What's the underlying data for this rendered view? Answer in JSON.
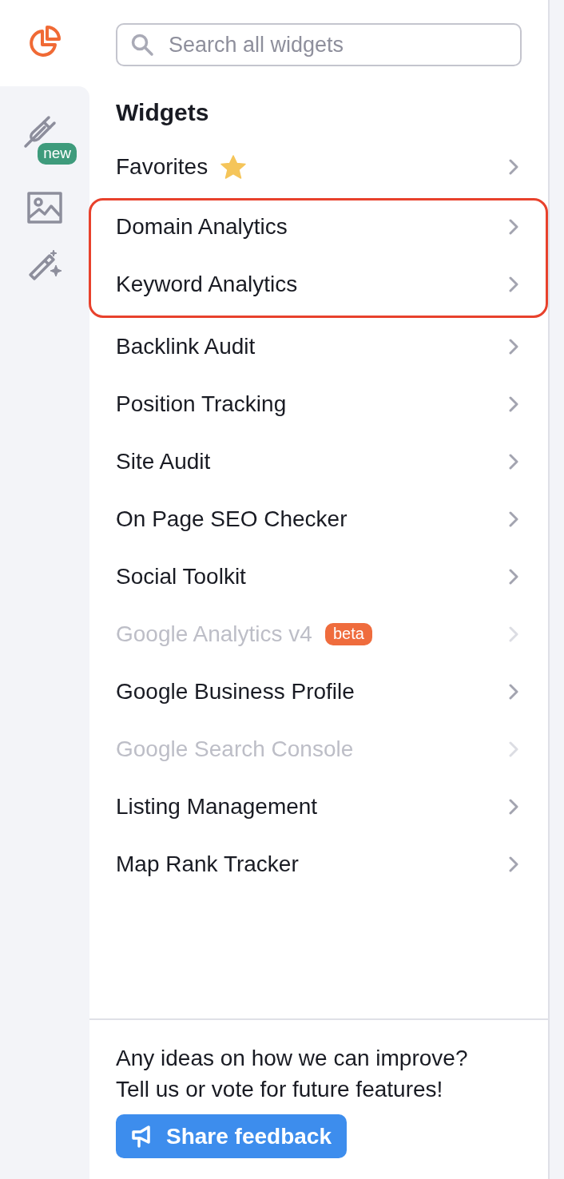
{
  "rail": [
    {
      "kind": "chart",
      "selected": true
    },
    {
      "kind": "plug",
      "selected": false,
      "badge": "new"
    },
    {
      "kind": "image",
      "selected": false
    },
    {
      "kind": "wand",
      "selected": false
    }
  ],
  "search": {
    "placeholder": "Search all widgets"
  },
  "heading": "Widgets",
  "items": [
    {
      "label": "Favorites",
      "kind": "favorites",
      "disabled": false,
      "highlighted": false
    },
    {
      "label": "Domain Analytics",
      "kind": "tool",
      "disabled": false,
      "highlighted": true
    },
    {
      "label": "Keyword Analytics",
      "kind": "tool",
      "disabled": false,
      "highlighted": true
    },
    {
      "label": "Backlink Audit",
      "kind": "tool",
      "disabled": false,
      "highlighted": false
    },
    {
      "label": "Position Tracking",
      "kind": "tool",
      "disabled": false,
      "highlighted": false
    },
    {
      "label": "Site Audit",
      "kind": "tool",
      "disabled": false,
      "highlighted": false
    },
    {
      "label": "On Page SEO Checker",
      "kind": "tool",
      "disabled": false,
      "highlighted": false
    },
    {
      "label": "Social Toolkit",
      "kind": "tool",
      "disabled": false,
      "highlighted": false
    },
    {
      "label": "Google Analytics v4",
      "kind": "tool",
      "disabled": true,
      "highlighted": false,
      "badge": "beta"
    },
    {
      "label": "Google Business Profile",
      "kind": "tool",
      "disabled": false,
      "highlighted": false
    },
    {
      "label": "Google Search Console",
      "kind": "tool",
      "disabled": true,
      "highlighted": false
    },
    {
      "label": "Listing Management",
      "kind": "tool",
      "disabled": false,
      "highlighted": false
    },
    {
      "label": "Map Rank Tracker",
      "kind": "tool",
      "disabled": false,
      "highlighted": false
    }
  ],
  "footer": {
    "lines": [
      "Any ideas on how we can improve?",
      "Tell us or vote for future features!"
    ],
    "button": "Share feedback"
  }
}
